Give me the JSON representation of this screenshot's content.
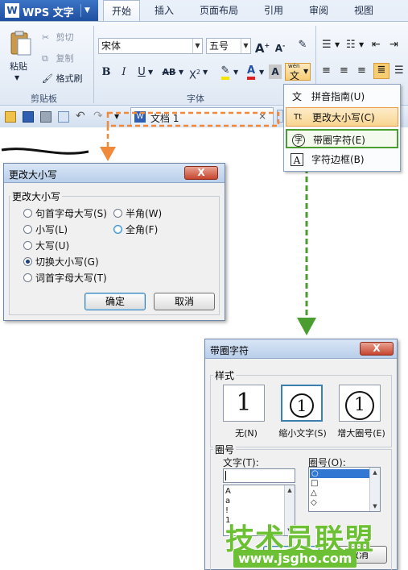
{
  "app": {
    "name": "WPS 文字",
    "logo": "W"
  },
  "tabs": [
    "开始",
    "插入",
    "页面布局",
    "引用",
    "审阅",
    "视图"
  ],
  "clipboard": {
    "paste": "粘贴",
    "cut": "剪切",
    "copy": "复制",
    "format_painter": "格式刷",
    "group": "剪贴板"
  },
  "font": {
    "name": "宋体",
    "size": "五号",
    "group": "字体",
    "grow": "A",
    "shrink": "A",
    "bold": "B",
    "italic": "I",
    "underline": "U",
    "strike": "AB",
    "superscript": "X",
    "color_a": "A",
    "text_a": "A",
    "phonetic": "wén",
    "phonetic_char": "文"
  },
  "doc": {
    "tab_title": "文档 1"
  },
  "menu": {
    "items": [
      {
        "label": "拼音指南(U)",
        "icon": "文"
      },
      {
        "label": "更改大小写(C)",
        "icon": "Tt"
      },
      {
        "label": "带圈字符(E)",
        "icon": "字"
      },
      {
        "label": "字符边框(B)",
        "icon": "A"
      }
    ]
  },
  "dlg1": {
    "title": "更改大小写",
    "close": "X",
    "legend": "更改大小写",
    "options": {
      "sentence": "句首字母大写(S)",
      "lower": "小写(L)",
      "upper": "大写(U)",
      "toggle": "切换大小写(G)",
      "title": "词首字母大写(T)",
      "half": "半角(W)",
      "full": "全角(F)"
    },
    "ok": "确定",
    "cancel": "取消"
  },
  "dlg2": {
    "title": "带圈字符",
    "close": "X",
    "style_legend": "样式",
    "styles": [
      {
        "label": "无(N)",
        "glyph": "1"
      },
      {
        "label": "缩小文字(S)",
        "glyph": "1"
      },
      {
        "label": "增大圈号(E)",
        "glyph": "1"
      }
    ],
    "enclosure_legend": "圈号",
    "text_label": "文字(T):",
    "symbol_label": "圈号(O):",
    "text_list": [
      "A",
      "a",
      "!",
      "1"
    ],
    "symbol_list": [
      "○",
      "□",
      "△",
      "◇"
    ],
    "ok": "确定",
    "cancel": "取消"
  },
  "watermark": {
    "cn": "技术员联盟",
    "url": "www.jsgho.com"
  },
  "colors": {
    "orange_dash": "#f08a3a",
    "green_dash": "#4a9d2f",
    "accent_blue": "#1f4f9f"
  }
}
